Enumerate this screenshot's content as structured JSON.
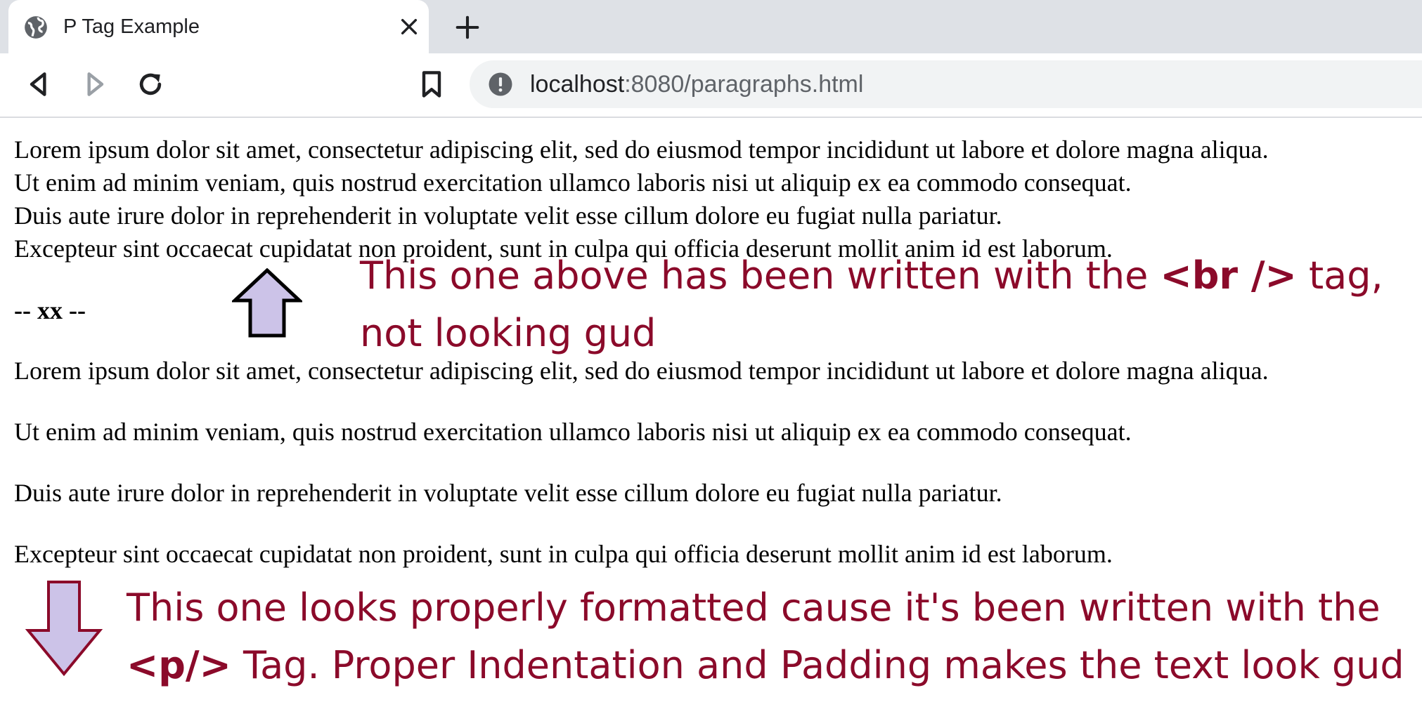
{
  "browser": {
    "tab_title": "P Tag Example",
    "url_host": "localhost",
    "url_rest": ":8080/paragraphs.html",
    "icons": {
      "favicon": "globe-icon",
      "close": "close-icon",
      "new_tab": "plus-icon",
      "back": "back-icon",
      "forward": "forward-icon",
      "reload": "reload-icon",
      "bookmark": "bookmark-icon",
      "site_info": "info-icon"
    }
  },
  "page": {
    "br_block_lines": [
      "Lorem ipsum dolor sit amet, consectetur adipiscing elit, sed do eiusmod tempor incididunt ut labore et dolore magna aliqua.",
      "Ut enim ad minim veniam, quis nostrud exercitation ullamco laboris nisi ut aliquip ex ea commodo consequat.",
      "Duis aute irure dolor in reprehenderit in voluptate velit esse cillum dolore eu fugiat nulla pariatur.",
      "Excepteur sint occaecat cupidatat non proident, sunt in culpa qui officia deserunt mollit anim id est laborum."
    ],
    "separator": "-- xx --",
    "paragraphs": [
      "Lorem ipsum dolor sit amet, consectetur adipiscing elit, sed do eiusmod tempor incididunt ut labore et dolore magna aliqua.",
      "Ut enim ad minim veniam, quis nostrud exercitation ullamco laboris nisi ut aliquip ex ea commodo consequat.",
      "Duis aute irure dolor in reprehenderit in voluptate velit esse cillum dolore eu fugiat nulla pariatur.",
      "Excepteur sint occaecat cupidatat non proident, sunt in culpa qui officia deserunt mollit anim id est laborum."
    ]
  },
  "annotations": {
    "top": {
      "line1_pre": "This one above has been written with the ",
      "line1_bold": "<br />",
      "line1_post": " tag,",
      "line2": "not looking gud"
    },
    "bottom": {
      "line1": "This one looks properly formatted cause it's been written with the",
      "line2_bold": "<p/>",
      "line2_post": " Tag. Proper Indentation and Padding makes the text look gud"
    },
    "colors": {
      "text": "#8b0a2a",
      "arrow_fill": "#ccc3e8",
      "arrow_up_stroke": "#000000",
      "arrow_down_stroke": "#8b0a2a"
    }
  }
}
